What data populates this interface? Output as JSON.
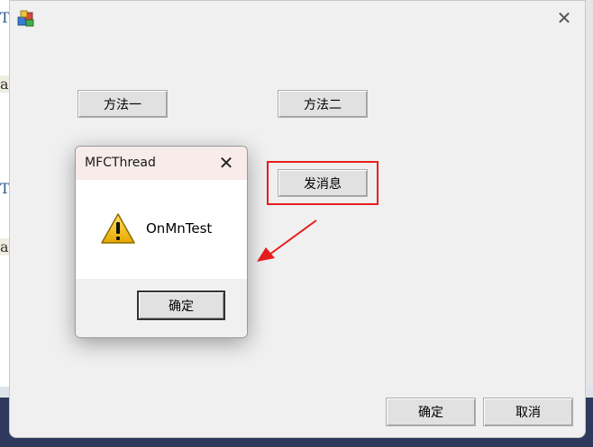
{
  "background_editor": {
    "glyphs": [
      "T",
      "a(",
      "T",
      "a("
    ]
  },
  "main_dialog": {
    "app_icon": "mfc-app-icon",
    "close_glyph": "✕",
    "buttons": {
      "method_one": "方法一",
      "method_two": "方法二",
      "send_message": "发消息",
      "ok": "确定",
      "cancel": "取消"
    }
  },
  "annotation": {
    "highlight_color": "#e81e1e",
    "arrow_icon": "red-arrow-icon"
  },
  "message_box": {
    "title": "MFCThread",
    "close_glyph": "✕",
    "icon": "warning-icon",
    "message": "OnMnTest",
    "ok_label": "确定"
  }
}
